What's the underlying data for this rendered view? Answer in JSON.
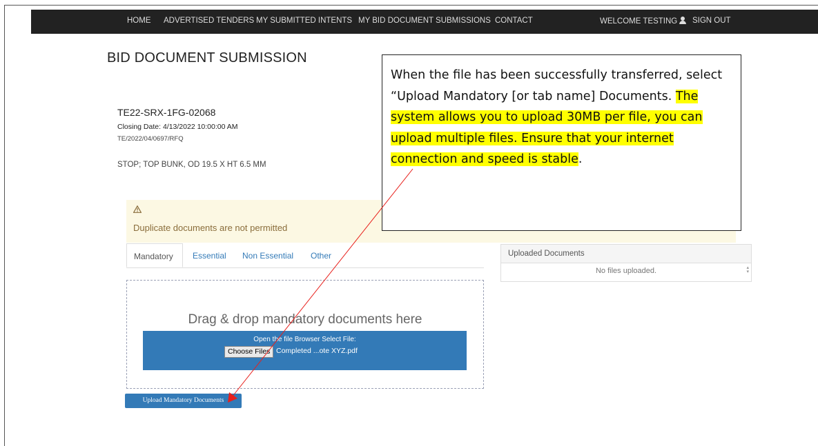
{
  "nav": {
    "home": "HOME",
    "advertised_tenders": "ADVERTISED TENDERS",
    "submitted_intents": "MY SUBMITTED INTENTS",
    "bid_submissions": "MY BID DOCUMENT SUBMISSIONS",
    "contact": "CONTACT",
    "welcome": "WELCOME TESTING",
    "user_icon": "user-icon",
    "sign_out": "SIGN OUT"
  },
  "page": {
    "title": "BID DOCUMENT SUBMISSION",
    "tender_code": "TE22-SRX-1FG-02068",
    "closing_date": "Closing Date: 4/13/2022 10:00:00 AM",
    "reference": "TE/2022/04/0697/RFQ",
    "description": "STOP; TOP BUNK, OD 19.5 X HT 6.5 MM"
  },
  "warning": {
    "icon": "warning-icon",
    "text": "Duplicate documents are not permitted"
  },
  "tabs": [
    {
      "label": "Mandatory",
      "active": true
    },
    {
      "label": "Essential",
      "active": false
    },
    {
      "label": "Non Essential",
      "active": false
    },
    {
      "label": "Other",
      "active": false
    }
  ],
  "dropzone": {
    "heading": "Drag & drop mandatory documents here",
    "browser_label": "Open the file Browser Select File:",
    "choose_button": "Choose Files",
    "selected_file": "Completed ...ote XYZ.pdf"
  },
  "upload_button": "Upload Mandatory Documents",
  "uploaded_panel": {
    "header": "Uploaded Documents",
    "empty_text": "No files uploaded."
  },
  "callout": {
    "plain": "When the file has been successfully transferred, select “Upload Mandatory [or tab name] Documents. ",
    "highlight_a": "The system allows you to upload 30MB per file, you can upload multiple files. Ensure that your internet connection and speed is stable",
    "tail": "."
  },
  "colors": {
    "navbar": "#222222",
    "primary": "#337ab7",
    "warning_bg": "#fcf8e3",
    "warning_text": "#8a6d3b",
    "highlight": "#ffff00",
    "arrow": "#e8201c"
  }
}
